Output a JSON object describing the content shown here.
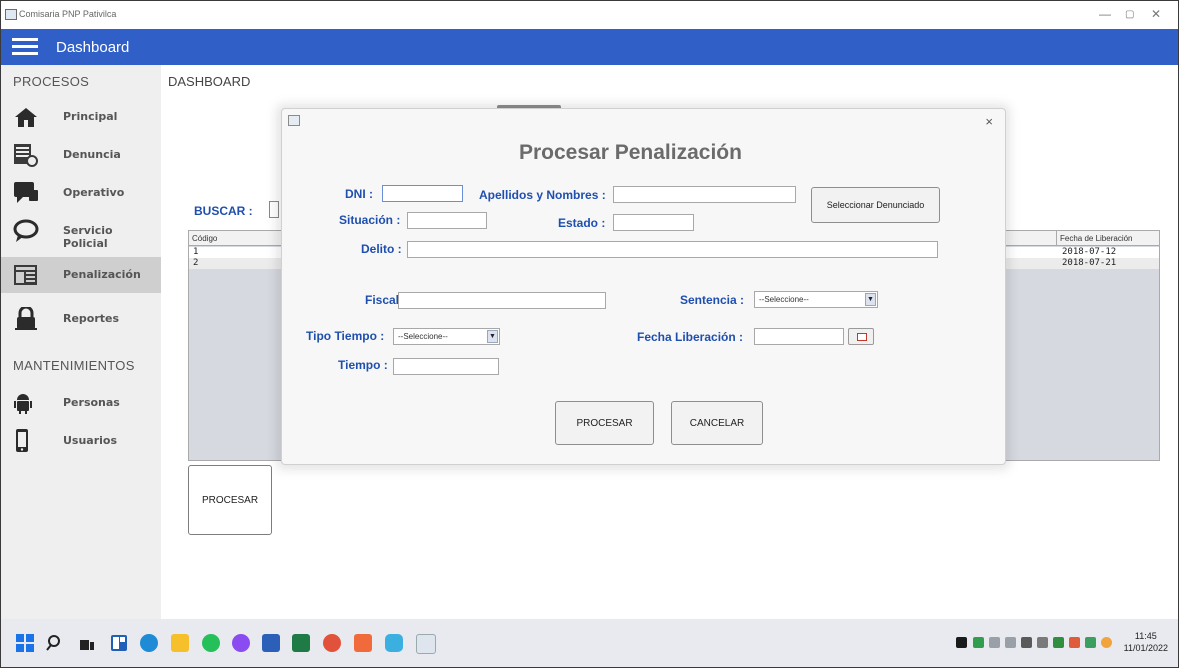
{
  "window": {
    "title": "Comisaria PNP Pativilca",
    "controls": {
      "minimize": "—",
      "maximize": "▢",
      "close": "✕"
    }
  },
  "header": {
    "title": "Dashboard"
  },
  "sidebar": {
    "section_procesos": "PROCESOS",
    "items": [
      {
        "label": "Principal",
        "icon": "home-icon"
      },
      {
        "label": "Denuncia",
        "icon": "document-icon"
      },
      {
        "label": "Operativo",
        "icon": "chat-icon"
      },
      {
        "label": "Servicio Policial",
        "icon": "speech-bubble-icon"
      },
      {
        "label": "Penalización",
        "icon": "newspaper-icon",
        "active": true
      },
      {
        "label": "Reportes",
        "icon": "lock-icon"
      }
    ],
    "section_mantenimientos": "MANTENIMIENTOS",
    "maint_items": [
      {
        "label": "Personas",
        "icon": "android-icon"
      },
      {
        "label": "Usuarios",
        "icon": "phone-icon"
      }
    ]
  },
  "main": {
    "title": "DASHBOARD",
    "buscar_label": "BUSCAR :",
    "table": {
      "col_codigo": "Código",
      "col_fecha": "Fecha de Liberación",
      "rows": [
        {
          "codigo": "1",
          "fecha": "2018-07-12"
        },
        {
          "codigo": "2",
          "fecha": "2018-07-21"
        }
      ]
    },
    "procesar_label": "PROCESAR"
  },
  "dialog": {
    "title": "Procesar Penalización",
    "close": "×",
    "dni_label": "DNI :",
    "apellidos_label": "Apellidos y Nombres :",
    "seleccionar_button": "Seleccionar Denunciado",
    "situacion_label": "Situación :",
    "estado_label": "Estado :",
    "delito_label": "Delito :",
    "fiscal_label": "Fiscal :",
    "sentencia_label": "Sentencia :",
    "sentencia_value": "--Seleccione--",
    "tipo_tiempo_label": "Tipo Tiempo :",
    "tipo_tiempo_value": "--Seleccione--",
    "fecha_liberacion_label": "Fecha Liberación :",
    "tiempo_label": "Tiempo :",
    "procesar_button": "PROCESAR",
    "cancelar_button": "CANCELAR"
  },
  "taskbar": {
    "time": "11:45",
    "date": "11/01/2022",
    "apps": [
      "start-icon",
      "search-icon",
      "task-view-icon",
      "widgets-icon",
      "edge-icon",
      "file-explorer-icon",
      "whatsapp-icon",
      "messenger-icon",
      "word-icon",
      "excel-icon",
      "chrome-icon",
      "app-icon",
      "browser-icon",
      "java-icon"
    ]
  }
}
